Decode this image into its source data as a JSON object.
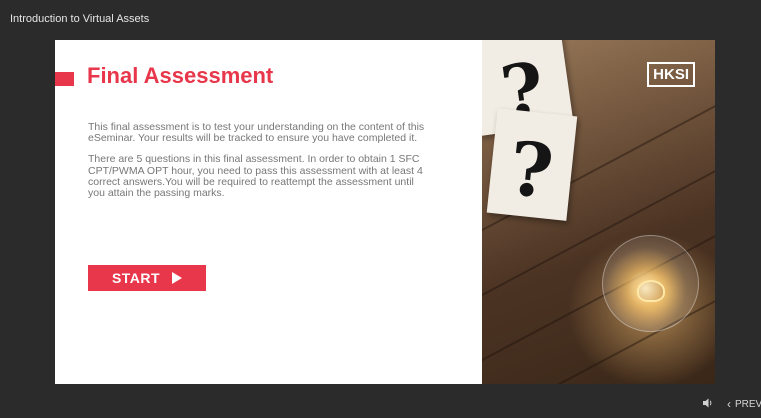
{
  "window": {
    "title": "Introduction to Virtual Assets"
  },
  "slide": {
    "heading": "Final Assessment",
    "paragraphs": [
      "This final assessment is to test your understanding on the content of this eSeminar. Your results will be tracked to ensure you have completed it.",
      "There are 5 questions in this final assessment. In order to obtain 1 SFC CPT/PWMA OPT hour, you need to pass this assessment with at least 4 correct answers.You will be required to reattempt the assessment until you attain the passing marks."
    ],
    "start_label": "START",
    "logo_text": "HKSI",
    "accent_color": "#e8364a"
  },
  "controls": {
    "prev_label": "PREV",
    "icons": [
      "volume-icon",
      "chevron-left-icon",
      "play-arrow-icon"
    ]
  }
}
